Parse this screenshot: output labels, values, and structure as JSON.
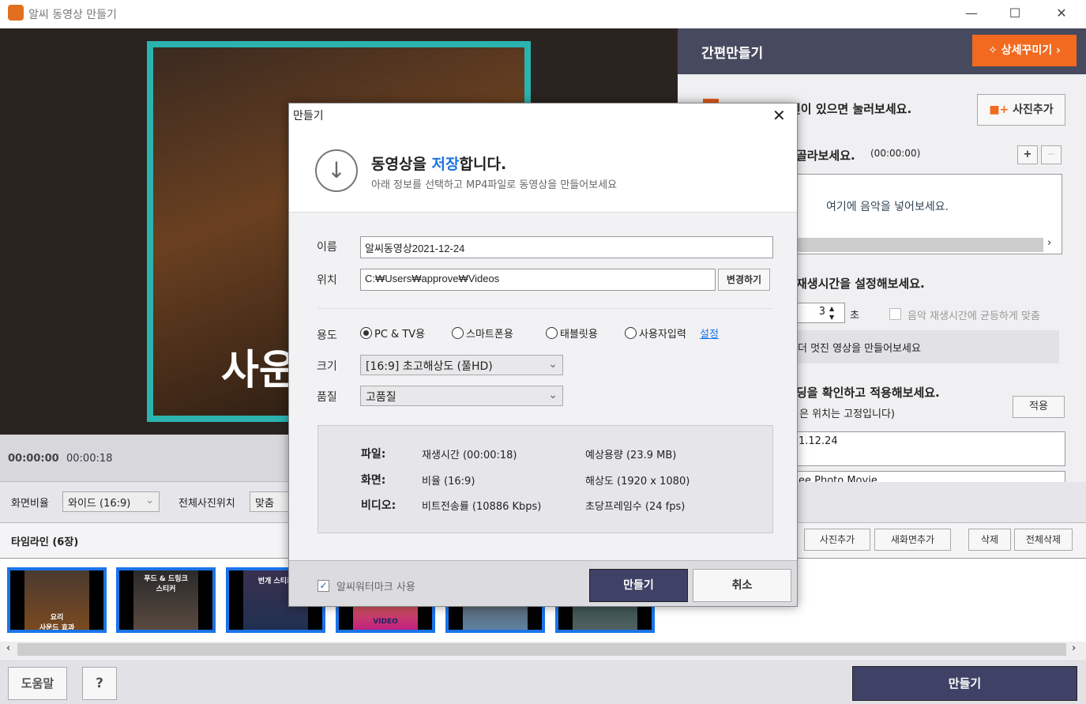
{
  "window": {
    "title": "알씨 동영상 만들기",
    "minimize": "—",
    "maximize": "☐",
    "close": "✕"
  },
  "preview": {
    "overlay_text": "사운",
    "time_current": "00:00:00",
    "time_total": "00:00:18"
  },
  "right_panel": {
    "title": "간편만들기",
    "detail_button": "상세꾸미기",
    "photo_hint": "진이 있으면 눌러보세요.",
    "add_photo": "사진추가",
    "music_hint": "골라보세요.",
    "music_time": "(00:00:00)",
    "music_placeholder": "여기에 음악을 넣어보세요.",
    "duration_title": "재생시간을 설정해보세요.",
    "duration_value": "3",
    "duration_unit": "초",
    "fit_music_label": "음악 재생시간에 균등하게 맞춤",
    "tip": "더 멋진 영상을 만들어보세요",
    "opening_title": "딩을 확인하고 적용해보세요.",
    "opening_note": "은 위치는 고정입니다)",
    "apply": "적용",
    "title_field": "1.12.24",
    "subtitle_field": "ee Photo Movie",
    "timeline_buttons": [
      "사진추가",
      "새화면추가",
      "삭제",
      "전체삭제"
    ]
  },
  "controls": {
    "ratio_label": "화면비율",
    "ratio_value": "와이드 (16:9)",
    "position_label": "전체사진위치",
    "position_value": "맞춤"
  },
  "timeline": {
    "title": "타임라인 (6장)",
    "thumbs": [
      "요리\n사운드 효과",
      "푸드 & 드링크\n스티커",
      "번개 스티커",
      "VIDEO",
      "",
      ""
    ]
  },
  "bottom": {
    "help": "도움말",
    "question": "?",
    "make": "만들기"
  },
  "dialog": {
    "title": "만들기",
    "heading_pre": "동영상을 ",
    "heading_accent": "저장",
    "heading_post": "합니다.",
    "subheading": "아래 정보를 선택하고 MP4파일로 동영상을 만들어보세요",
    "name_label": "이름",
    "name_value": "알씨동영상2021-12-24",
    "location_label": "위치",
    "location_value": "C:₩Users₩approve₩Videos",
    "change_button": "변경하기",
    "usage_label": "용도",
    "usage_options": [
      "PC & TV용",
      "스마트폰용",
      "태블릿용",
      "사용자입력"
    ],
    "usage_selected": "PC & TV용",
    "usage_setting_link": "설정",
    "size_label": "크기",
    "size_value": "[16:9] 초고해상도 (풀HD)",
    "quality_label": "품질",
    "quality_value": "고품질",
    "info": {
      "file_label": "파일:",
      "duration": "재생시간 (00:00:18)",
      "est_size": "예상용량 (23.9 MB)",
      "screen_label": "화면:",
      "ratio": "비율 (16:9)",
      "resolution": "해상도 (1920 x 1080)",
      "video_label": "비디오:",
      "bitrate": "비트전송률 (10886 Kbps)",
      "fps": "초당프레임수 (24 fps)"
    },
    "watermark_label": "알씨워터마크 사용",
    "watermark_checked": true,
    "make_button": "만들기",
    "cancel_button": "취소"
  },
  "colors": {
    "accent_orange": "#f26a1f",
    "header_dark": "#474a5e",
    "primary_button": "#3f4266",
    "thumb_border": "#1b74e8",
    "link_blue": "#1a73e8"
  }
}
